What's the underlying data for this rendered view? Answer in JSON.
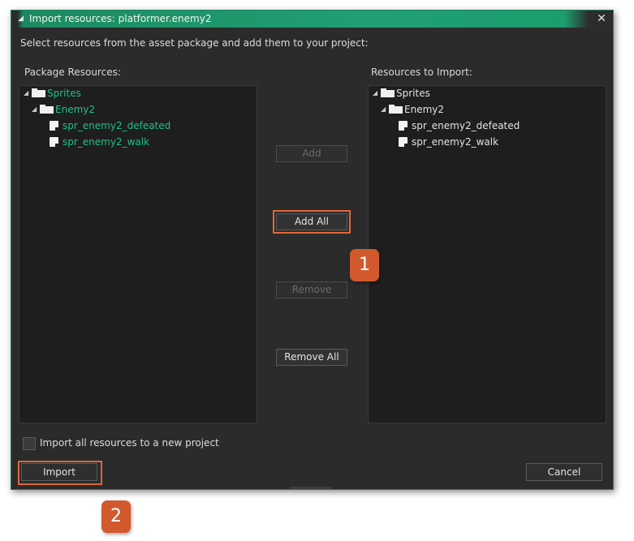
{
  "window": {
    "title": "Import resources: platformer.enemy2",
    "title_arrow": "◢",
    "close_glyph": "✕",
    "instructions": "Select resources from the asset package and add them to your project:"
  },
  "package_panel": {
    "label": "Package Resources:",
    "folder": "Sprites",
    "subfolder": "Enemy2",
    "items": [
      "spr_enemy2_defeated",
      "spr_enemy2_walk"
    ]
  },
  "import_panel": {
    "label": "Resources to Import:",
    "folder": "Sprites",
    "subfolder": "Enemy2",
    "items": [
      "spr_enemy2_defeated",
      "spr_enemy2_walk"
    ]
  },
  "buttons": {
    "add": "Add",
    "add_all": "Add All",
    "remove": "Remove",
    "remove_all": "Remove All",
    "import": "Import",
    "cancel": "Cancel"
  },
  "checkbox": {
    "label": "Import all resources to a new project",
    "checked": false
  },
  "callouts": [
    "1",
    "2"
  ],
  "icons": {
    "tree_expanded": "◢",
    "folder": "folder-icon",
    "sprite": "sprite-icon"
  },
  "colors": {
    "accent_green": "#1a9b6e",
    "tree_text_green": "#21c082",
    "callout_orange": "#d2592e",
    "window_bg": "#2b2b2b"
  }
}
